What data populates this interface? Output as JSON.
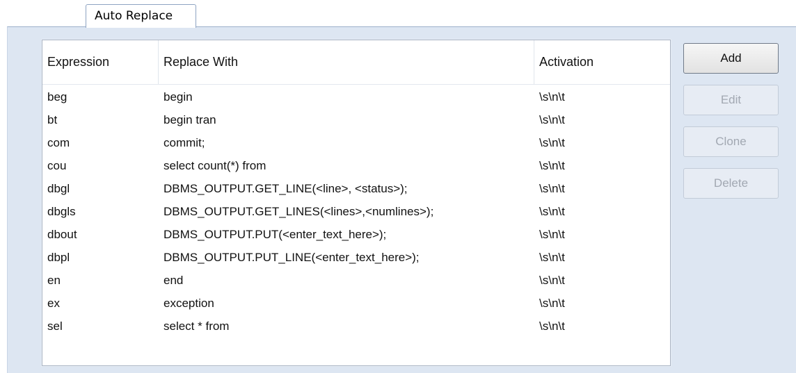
{
  "tab": {
    "label": "Auto Replace"
  },
  "table": {
    "headers": [
      "Expression",
      "Replace With",
      "Activation"
    ],
    "rows": [
      [
        "beg",
        "begin",
        "\\s\\n\\t"
      ],
      [
        "bt",
        "begin tran",
        "\\s\\n\\t"
      ],
      [
        "com",
        "commit;",
        "\\s\\n\\t"
      ],
      [
        "cou",
        "select count(*) from",
        "\\s\\n\\t"
      ],
      [
        "dbgl",
        "DBMS_OUTPUT.GET_LINE(<line>, <status>);",
        "\\s\\n\\t"
      ],
      [
        "dbgls",
        "DBMS_OUTPUT.GET_LINES(<lines>,<numlines>);",
        "\\s\\n\\t"
      ],
      [
        "dbout",
        "DBMS_OUTPUT.PUT(<enter_text_here>);",
        "\\s\\n\\t"
      ],
      [
        "dbpl",
        "DBMS_OUTPUT.PUT_LINE(<enter_text_here>);",
        "\\s\\n\\t"
      ],
      [
        "en",
        "end",
        "\\s\\n\\t"
      ],
      [
        "ex",
        "exception",
        "\\s\\n\\t"
      ],
      [
        "sel",
        "select * from",
        "\\s\\n\\t"
      ]
    ]
  },
  "buttons": {
    "add": {
      "label": "Add",
      "enabled": true
    },
    "edit": {
      "label": "Edit",
      "enabled": false
    },
    "clone": {
      "label": "Clone",
      "enabled": false
    },
    "delete": {
      "label": "Delete",
      "enabled": false
    }
  },
  "colors": {
    "panel_background": "#dde6f2",
    "disabled_text": "#a2a8b2"
  }
}
